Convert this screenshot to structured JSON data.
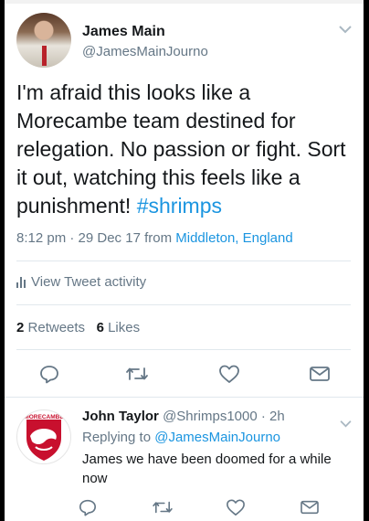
{
  "tweet": {
    "author_name": "James Main",
    "author_handle": "@JamesMainJourno",
    "text_main": "I'm afraid this looks like a Morecambe team destined for relegation. No passion or fight. Sort it out, watching this feels like a punishment!",
    "hashtag": "#shrimps",
    "time_date": "8:12 pm · 29 Dec 17",
    "from_label": "from",
    "location": "Middleton, England",
    "activity_label": "View Tweet activity",
    "retweets_count": "2",
    "retweets_label": "Retweets",
    "likes_count": "6",
    "likes_label": "Likes"
  },
  "reply": {
    "author_name": "John Taylor",
    "author_handle": "@Shrimps1000",
    "time": "· 2h",
    "replying_label": "Replying to",
    "replying_handle": "@JamesMainJourno",
    "text": "James we have been doomed for a while now",
    "crest_text": "MORECAMBE"
  },
  "icons": {
    "reply": "reply-icon",
    "retweet": "retweet-icon",
    "like": "heart-icon",
    "dm": "envelope-icon",
    "chevron": "chevron-down-icon",
    "activity": "bar-chart-icon"
  },
  "colors": {
    "link": "#1b95e0",
    "secondary_text": "#657786",
    "divider": "#e1e8ed",
    "crest_red": "#c8102e"
  }
}
